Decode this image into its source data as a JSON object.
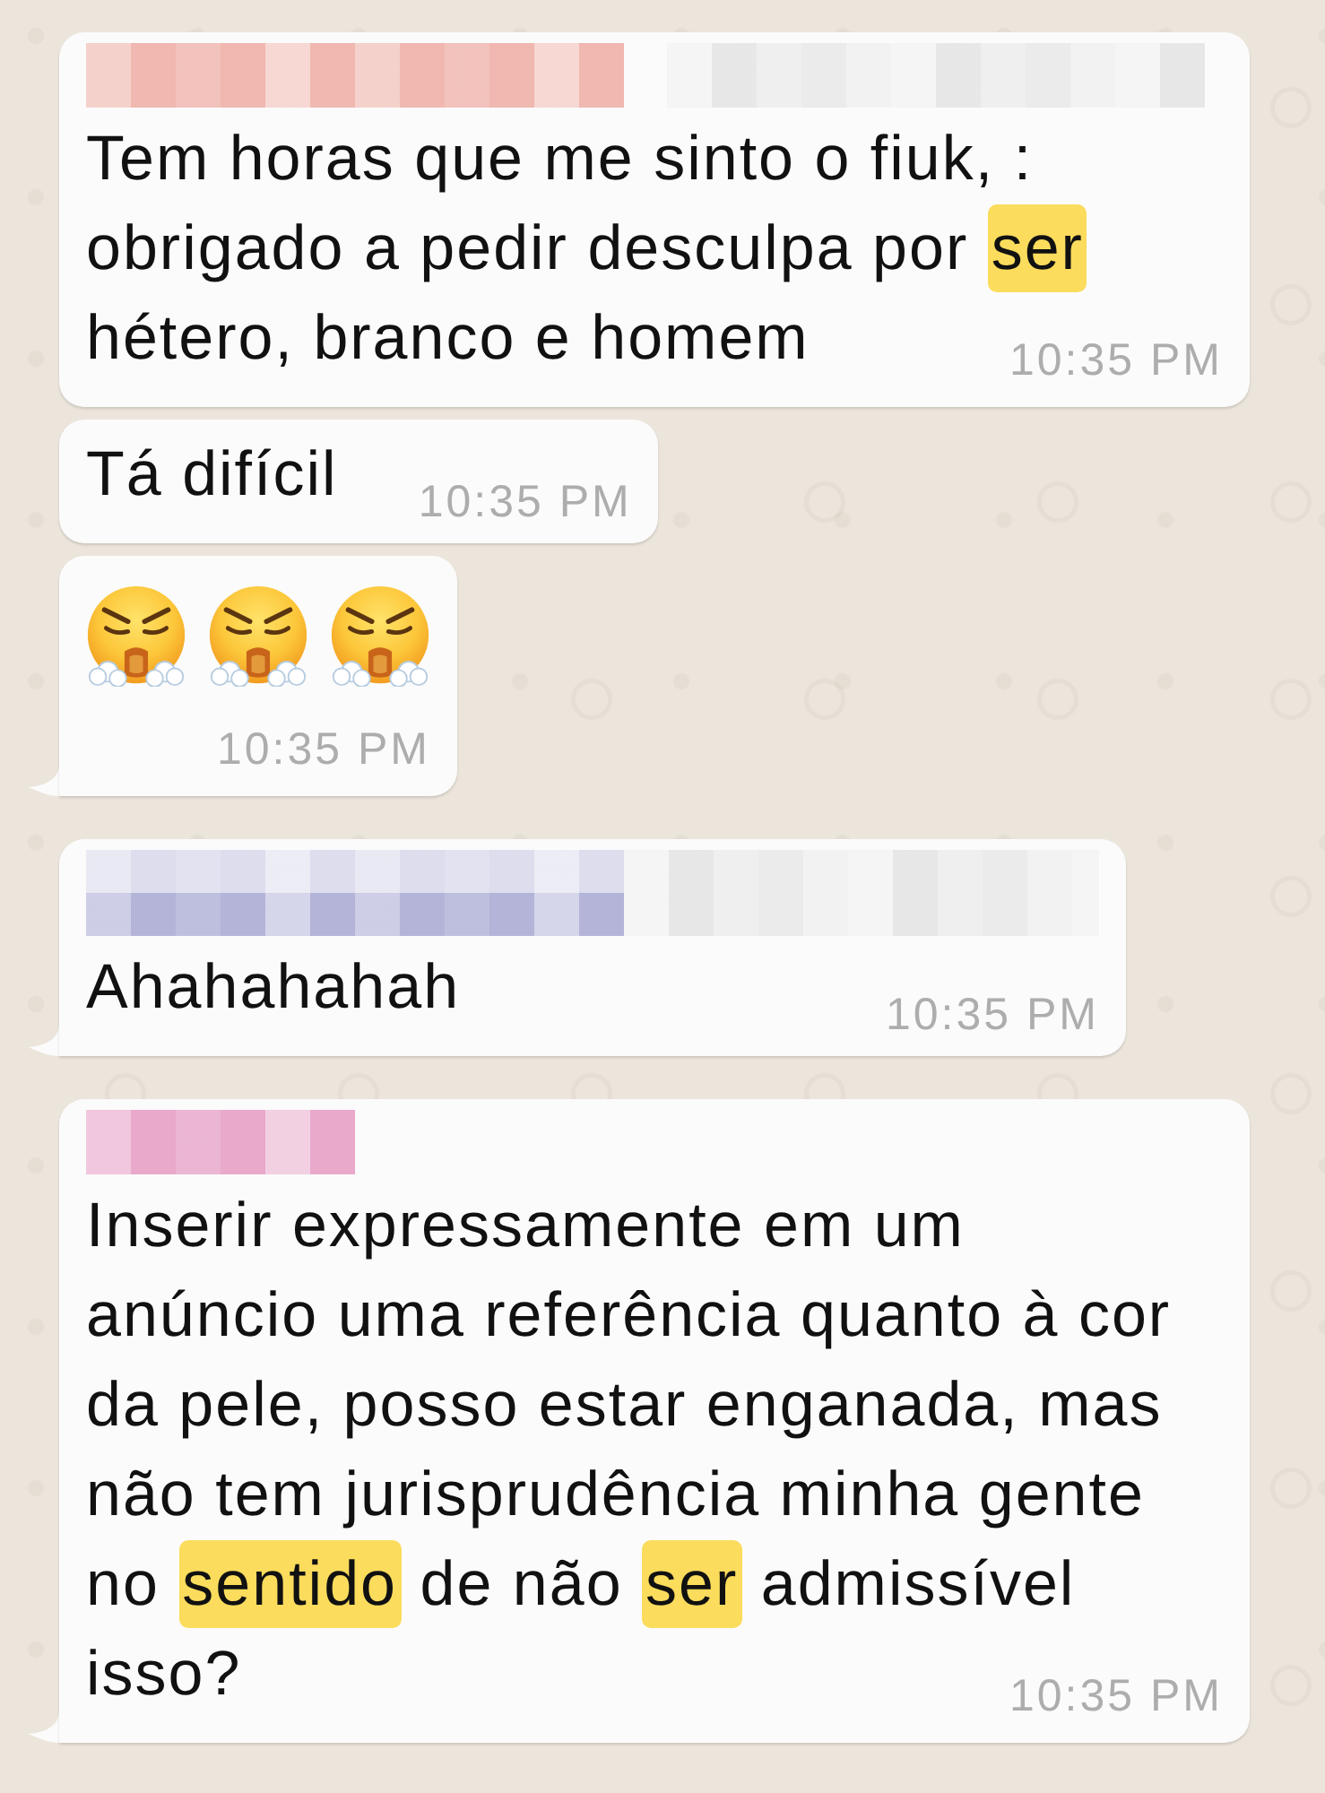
{
  "messages": [
    {
      "kind": "text",
      "tail": false,
      "sender": {
        "kind": "long",
        "color": "#f0b8b0"
      },
      "lines": [
        [
          {
            "text": "Tem horas que me sinto o fiuk, :",
            "highlighted": false
          }
        ],
        [
          {
            "text": "obrigado a pedir desculpa por ",
            "highlighted": false
          },
          {
            "text": "ser",
            "highlighted": true
          }
        ],
        [
          {
            "text": "hétero, branco e homem",
            "highlighted": false
          }
        ]
      ],
      "time": "10:35 PM"
    },
    {
      "kind": "text",
      "tail": false,
      "lines": [
        [
          {
            "text": "Tá difícil",
            "highlighted": false
          }
        ]
      ],
      "time": "10:35 PM"
    },
    {
      "kind": "emoji",
      "tail": true,
      "emojis": [
        {
          "kind": "face_with_steam"
        },
        {
          "kind": "face_with_steam"
        },
        {
          "kind": "face_with_steam"
        }
      ],
      "time": "10:35 PM"
    },
    {
      "kind": "text",
      "tail": true,
      "sender": {
        "kind": "stacked",
        "color": "#b3b4d8"
      },
      "lines": [
        [
          {
            "text": "Ahahahahah",
            "highlighted": false
          }
        ]
      ],
      "time": "10:35 PM"
    },
    {
      "kind": "text",
      "tail": true,
      "sender": {
        "kind": "short",
        "color": "#e8a9cb"
      },
      "lines": [
        [
          {
            "text": "Inserir expressamente em um",
            "highlighted": false
          }
        ],
        [
          {
            "text": "anúncio uma referência quanto à cor",
            "highlighted": false
          }
        ],
        [
          {
            "text": "da pele, posso estar enganada, mas",
            "highlighted": false
          }
        ],
        [
          {
            "text": "não tem jurisprudência minha gente",
            "highlighted": false
          }
        ],
        [
          {
            "text": "no ",
            "highlighted": false
          },
          {
            "text": "sentido",
            "highlighted": true
          },
          {
            "text": " de não ",
            "highlighted": false
          },
          {
            "text": "ser",
            "highlighted": true
          },
          {
            "text": " admissível",
            "highlighted": false
          }
        ],
        [
          {
            "text": "isso?",
            "highlighted": false
          }
        ]
      ],
      "time": "10:35 PM"
    }
  ]
}
